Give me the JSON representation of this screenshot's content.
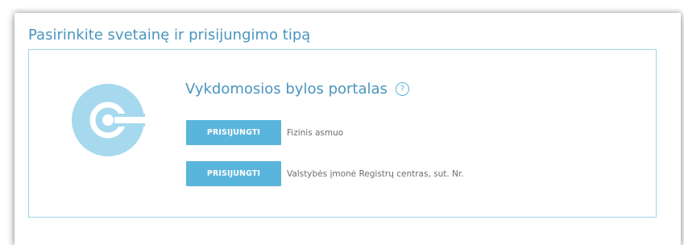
{
  "page": {
    "title": "Pasirinkite svetainę ir prisijungimo tipą"
  },
  "portal": {
    "name": "Vykdomosios bylos portalas",
    "help_icon": "question-mark-icon",
    "logo_icon": "key-logo-icon",
    "help_glyph": "?",
    "logins": [
      {
        "button_label": "PRISIJUNGTI",
        "description": "Fizinis asmuo"
      },
      {
        "button_label": "PRISIJUNGTI",
        "description": "Valstybės įmonė Registrų centras, sut. Nr."
      }
    ]
  },
  "colors": {
    "title": "#4a95bd",
    "button": "#5ab5dc",
    "card_border": "#9fd3ea",
    "logo": "#a6d9ed"
  }
}
